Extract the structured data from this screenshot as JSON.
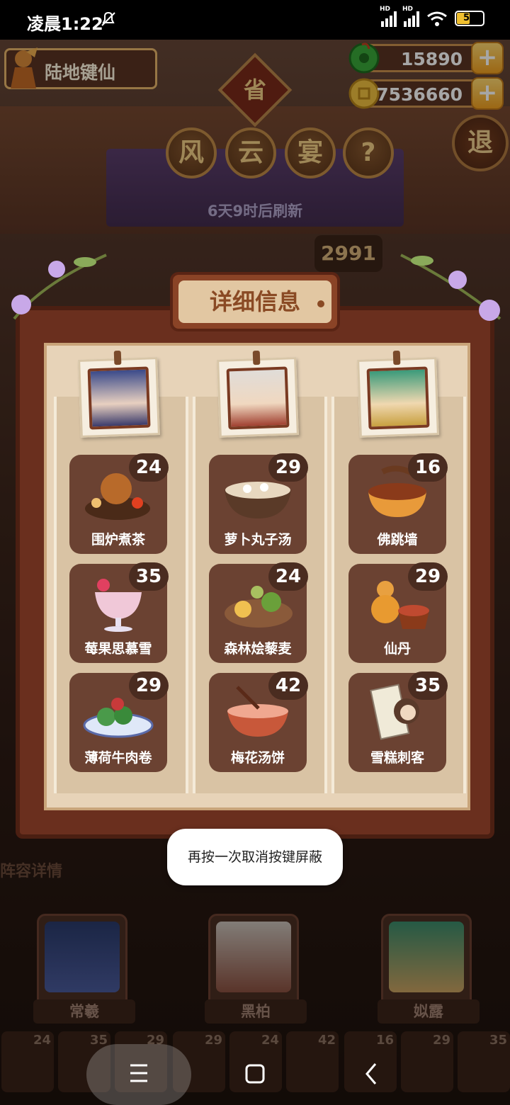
{
  "status_bar": {
    "time": "凌晨1:22",
    "signal_badge": "HD",
    "battery_level": "50"
  },
  "player": {
    "name": "陆地键仙"
  },
  "resources": {
    "jade": "15890",
    "coins": "7536660"
  },
  "header": {
    "province_label": "省",
    "title_chars": [
      "风",
      "云",
      "宴"
    ],
    "help_label": "?",
    "exit_label": "退",
    "refresh_text": "6天9时后刷新",
    "score": "2991"
  },
  "dialog": {
    "title": "详细信息",
    "columns": [
      {
        "dishes": [
          {
            "name": "围炉煮茶",
            "count": "24"
          },
          {
            "name": "莓果思慕雪",
            "count": "35"
          },
          {
            "name": "薄荷牛肉卷",
            "count": "29"
          }
        ]
      },
      {
        "dishes": [
          {
            "name": "萝卜丸子汤",
            "count": "29"
          },
          {
            "name": "森林烩藜麦",
            "count": "24"
          },
          {
            "name": "梅花汤饼",
            "count": "42"
          }
        ]
      },
      {
        "dishes": [
          {
            "name": "佛跳墙",
            "count": "16"
          },
          {
            "name": "仙丹",
            "count": "29"
          },
          {
            "name": "雪糕刺客",
            "count": "35"
          }
        ]
      }
    ]
  },
  "lineup": {
    "label": "阵容详情",
    "heroes": [
      {
        "name": "常羲"
      },
      {
        "name": "黑柏"
      },
      {
        "name": "姒露"
      }
    ],
    "mini_counts": [
      "24",
      "35",
      "29",
      "29",
      "24",
      "42",
      "16",
      "29",
      "35"
    ]
  },
  "toast": {
    "message": "再按一次取消按键屏蔽"
  },
  "colors": {
    "accent": "#f0a020",
    "panel": "#6a2f1e",
    "paper": "#e7d3b8",
    "dish_card": "#6b4232"
  }
}
